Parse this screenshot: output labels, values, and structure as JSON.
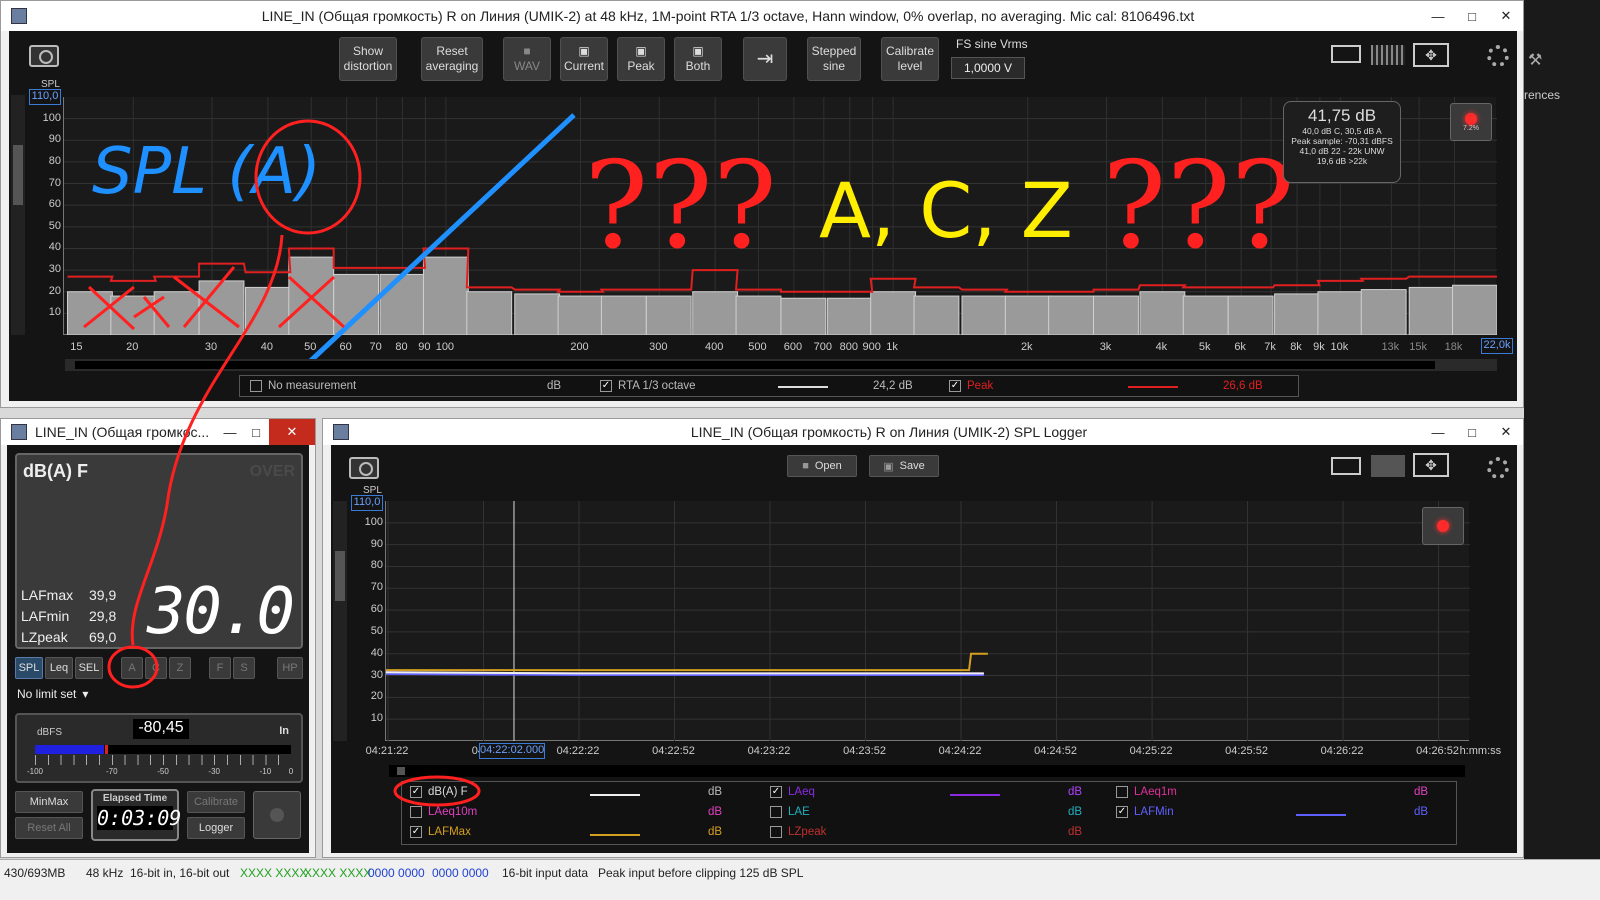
{
  "rta_window": {
    "title": "LINE_IN (Общая громкость) R on Линия (UMIK-2) at 48 kHz, 1M-point RTA 1/3 octave, Hann window, 0% overlap, no averaging. Mic cal: 8106496.txt",
    "toolbar": {
      "show_distortion": "Show distortion",
      "reset_averaging": "Reset averaging",
      "wav": "WAV",
      "current": "Current",
      "peak": "Peak",
      "both": "Both",
      "stepped_sine": "Stepped sine",
      "calibrate_level": "Calibrate level",
      "fs_sine_label": "FS sine Vrms",
      "fs_sine_value": "1,0000 V"
    },
    "y_axis_unit": "SPL",
    "y_axis_top": "110,0",
    "y_ticks": [
      "100",
      "90",
      "80",
      "70",
      "60",
      "50",
      "40",
      "30",
      "20",
      "10"
    ],
    "x_ticks": [
      {
        "label": "15",
        "dim": false
      },
      {
        "label": "20",
        "dim": false
      },
      {
        "label": "30",
        "dim": false
      },
      {
        "label": "40",
        "dim": false
      },
      {
        "label": "50",
        "dim": false
      },
      {
        "label": "60",
        "dim": false
      },
      {
        "label": "70",
        "dim": false
      },
      {
        "label": "80",
        "dim": false
      },
      {
        "label": "90",
        "dim": false
      },
      {
        "label": "100",
        "dim": false
      },
      {
        "label": "200",
        "dim": false
      },
      {
        "label": "300",
        "dim": false
      },
      {
        "label": "400",
        "dim": false
      },
      {
        "label": "500",
        "dim": false
      },
      {
        "label": "600",
        "dim": false
      },
      {
        "label": "700",
        "dim": false
      },
      {
        "label": "800",
        "dim": false
      },
      {
        "label": "900",
        "dim": false
      },
      {
        "label": "1k",
        "dim": false
      },
      {
        "label": "2k",
        "dim": false
      },
      {
        "label": "3k",
        "dim": false
      },
      {
        "label": "4k",
        "dim": false
      },
      {
        "label": "5k",
        "dim": false
      },
      {
        "label": "6k",
        "dim": false
      },
      {
        "label": "7k",
        "dim": false
      },
      {
        "label": "8k",
        "dim": false
      },
      {
        "label": "9k",
        "dim": false
      },
      {
        "label": "10k",
        "dim": false
      },
      {
        "label": "13k",
        "dim": true
      },
      {
        "label": "15k",
        "dim": true
      },
      {
        "label": "18k",
        "dim": true
      }
    ],
    "x_end_label": "22,0k",
    "readout": {
      "main": "41,75 dB",
      "line1": "40,0 dB C, 30,5 dB A",
      "line2": "Peak sample: -70,31 dBFS",
      "line3": "41,0 dB 22 - 22k UNW",
      "line4": "19,6 dB >22k"
    },
    "rec_percent": "7.2%",
    "legend": {
      "no_measurement": "No measurement",
      "db": "dB",
      "rta_label": "RTA 1/3 octave",
      "rta_value": "24,2 dB",
      "peak_label": "Peak",
      "peak_value": "26,6 dB"
    },
    "annotations": {
      "spl_a": "SPL (A)",
      "acz": "A, C, Z",
      "q1": "???",
      "q2": "???"
    },
    "side_text": "rences"
  },
  "spl_meter": {
    "title": "LINE_IN (Общая громкос...",
    "weighting": "dB(A) F",
    "over": "OVER",
    "lafmax_label": "LAFmax",
    "lafmax_value": "39,9",
    "lafmin_label": "LAFmin",
    "lafmin_value": "29,8",
    "lzpeak_label": "LZpeak",
    "lzpeak_value": "69,0",
    "big_value": "30.0",
    "modes": [
      "SPL",
      "Leq",
      "SEL"
    ],
    "weights": [
      "A",
      "C",
      "Z"
    ],
    "speeds": [
      "F",
      "S"
    ],
    "hp": "HP",
    "limit": "No limit set",
    "dbfs_label": "dBFS",
    "dbfs_value": "-80,45",
    "input_label": "In",
    "dbfs_fill_fraction": 0.27,
    "dbfs_ticks": [
      "-100",
      "-70",
      "-50",
      "-30",
      "-10",
      "0"
    ],
    "minmax": "MinMax",
    "reset_all": "Reset All",
    "elapsed_label": "Elapsed Time",
    "elapsed_value": "0:03:09",
    "calibrate": "Calibrate",
    "logger": "Logger"
  },
  "logger_window": {
    "title": "LINE_IN (Общая громкость) R on Линия (UMIK-2) SPL Logger",
    "open": "Open",
    "save": "Save",
    "y_axis_unit": "SPL",
    "y_axis_top": "110,0",
    "y_ticks": [
      "100",
      "90",
      "80",
      "70",
      "60",
      "50",
      "40",
      "30",
      "20",
      "10"
    ],
    "x_ticks": [
      "04:21:22",
      "04:2",
      "04:22:22",
      "04:22:52",
      "04:23:22",
      "04:23:52",
      "04:24:22",
      "04:24:52",
      "04:25:22",
      "04:25:52",
      "04:26:22",
      "04:26:52"
    ],
    "x_unit": "h:mm:ss",
    "cursor_time": "04:22:02.000",
    "legend": [
      {
        "label": "dB(A) F",
        "checked": true,
        "color": "#eeeeee",
        "unit": "dB",
        "unit_color": "#bbbbbb"
      },
      {
        "label": "LAeq",
        "checked": true,
        "color": "#8a2be2",
        "unit": "dB",
        "unit_color": "#b040ff"
      },
      {
        "label": "LAeq1m",
        "checked": false,
        "color": "#e0309a",
        "unit": "dB",
        "unit_color": "#e040c0"
      },
      {
        "label": "LAeq10m",
        "checked": false,
        "color": "#e040c0",
        "unit": "dB",
        "unit_color": "#e040c0"
      },
      {
        "label": "LAE",
        "checked": false,
        "color": "#20b0c0",
        "unit": "dB",
        "unit_color": "#20b0c0"
      },
      {
        "label": "LAFMin",
        "checked": true,
        "color": "#6060ff",
        "unit": "dB",
        "unit_color": "#6060ff"
      },
      {
        "label": "LAFMax",
        "checked": true,
        "color": "#d4a020",
        "unit": "dB",
        "unit_color": "#d4a020"
      },
      {
        "label": "LZpeak",
        "checked": false,
        "color": "#c03030",
        "unit": "dB",
        "unit_color": "#c03030"
      }
    ]
  },
  "status_bar": {
    "memory": "430/693MB",
    "rate": "48 kHz",
    "bits": "16-bit in, 16-bit out",
    "green1": "XXXX XXXX",
    "green2": "XXXX XXXX",
    "blue1": "0000 0000",
    "blue2": "0000 0000",
    "input_data": "16-bit input data",
    "peak": "Peak input before clipping 125 dB SPL"
  },
  "chart_data": [
    {
      "type": "bar",
      "title": "",
      "xlabel": "",
      "ylabel": "SPL",
      "ylim": [
        0,
        110
      ],
      "x_scale": "log",
      "categories": [
        "16",
        "20",
        "25",
        "31.5",
        "40",
        "50",
        "63",
        "80",
        "100",
        "125",
        "160",
        "200",
        "250",
        "315",
        "400",
        "500",
        "630",
        "800",
        "1k",
        "1.25k",
        "1.6k",
        "2k",
        "2.5k",
        "3.15k",
        "4k",
        "5k",
        "6.3k",
        "8k",
        "10k",
        "12.5k",
        "16k",
        "20k"
      ],
      "series": [
        {
          "name": "RTA 1/3 octave",
          "values": [
            20,
            18,
            20,
            25,
            22,
            36,
            28,
            28,
            36,
            20,
            19,
            18,
            18,
            18,
            20,
            18,
            17,
            17,
            20,
            18,
            18,
            18,
            18,
            18,
            20,
            18,
            18,
            19,
            20,
            21,
            22,
            23
          ],
          "color": "#c8c8c8"
        },
        {
          "name": "Peak",
          "values": [
            27,
            25,
            27,
            33,
            29,
            40,
            31,
            31,
            40,
            22,
            21,
            20,
            21,
            21,
            30,
            21,
            20,
            20,
            26,
            22,
            21,
            20,
            20,
            21,
            23,
            22,
            22,
            23,
            25,
            26,
            27,
            27
          ],
          "color": "#e02020"
        }
      ]
    },
    {
      "type": "line",
      "title": "",
      "ylabel": "SPL",
      "ylim": [
        0,
        110
      ],
      "x": [
        "04:21:22",
        "04:22:22",
        "04:23:22",
        "04:24:22",
        "04:24:30"
      ],
      "series": [
        {
          "name": "LAFMax",
          "values": [
            32.5,
            32.5,
            32.5,
            32.5,
            40
          ],
          "color": "#d4a020"
        },
        {
          "name": "LAeq",
          "values": [
            31.5,
            31,
            31,
            31,
            31
          ],
          "color": "#8a2be2"
        },
        {
          "name": "LAFMin",
          "values": [
            31,
            30.5,
            30.5,
            30.5,
            30.5
          ],
          "color": "#6060ff"
        },
        {
          "name": "dB(A) F",
          "values": [
            31.5,
            31,
            31,
            31,
            31
          ],
          "color": "#eeeeee"
        }
      ]
    }
  ]
}
